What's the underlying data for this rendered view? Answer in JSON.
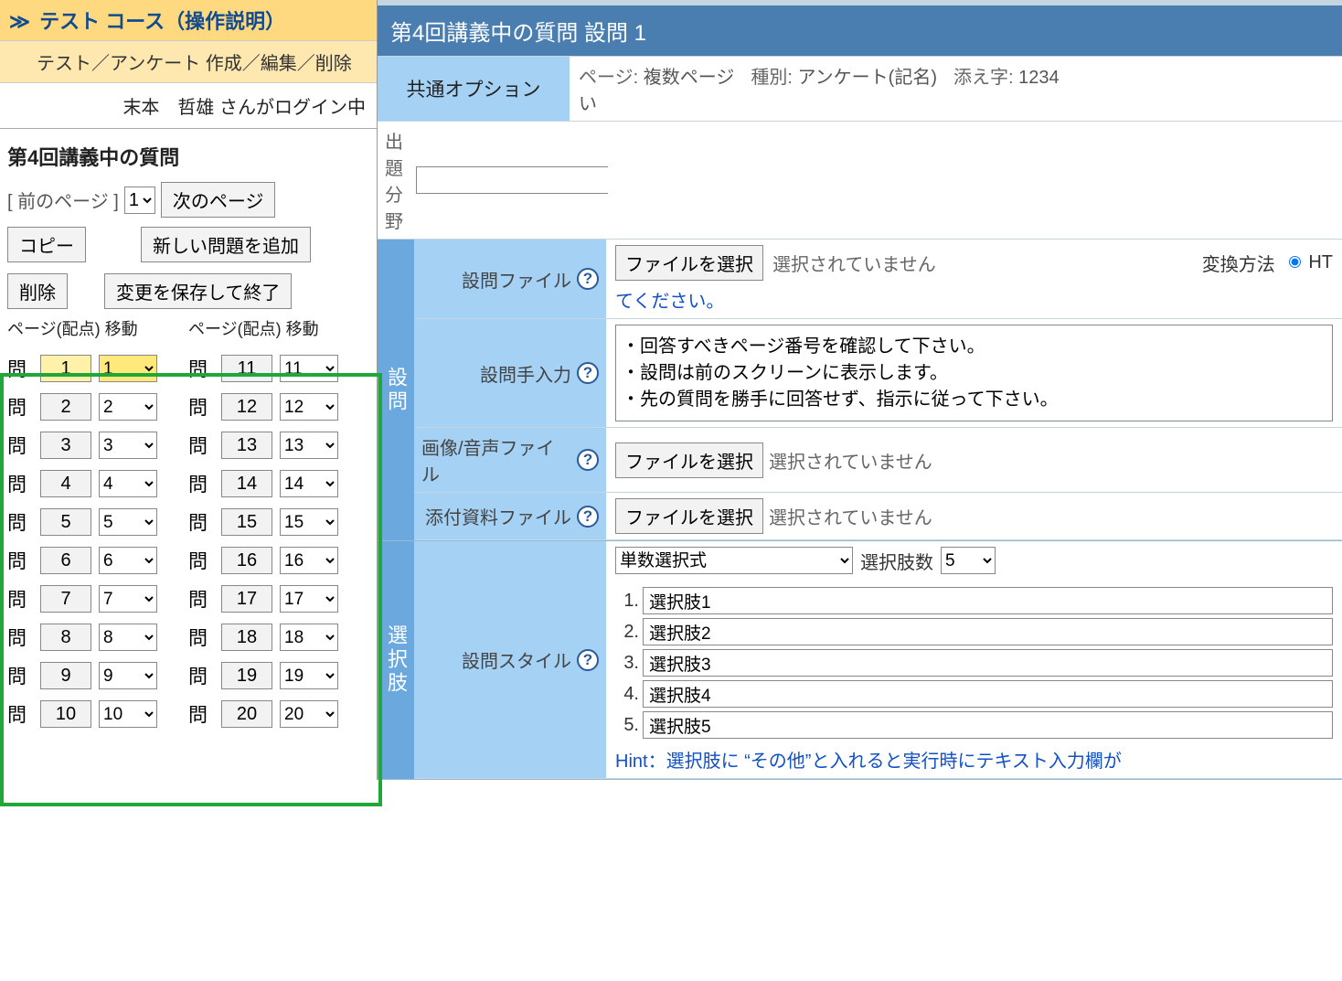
{
  "left": {
    "course_title": "テスト コース（操作説明）",
    "breadcrumb": "テスト／アンケート 作成／編集／削除",
    "login_status": "末本　哲雄 さんがログイン中",
    "qset_title": "第4回講義中の質問",
    "prev_label": "前のページ",
    "page_value": "1",
    "next_label": "次のページ",
    "copy_btn": "コピー",
    "add_btn": "新しい問題を追加",
    "delete_btn": "削除",
    "save_btn": "変更を保存して終了",
    "col_head_left": "ページ(配点) 移動",
    "col_head_right": "ページ(配点) 移動",
    "q_label": "問",
    "q_left": [
      {
        "n": "1",
        "p": "1"
      },
      {
        "n": "2",
        "p": "2"
      },
      {
        "n": "3",
        "p": "3"
      },
      {
        "n": "4",
        "p": "4"
      },
      {
        "n": "5",
        "p": "5"
      },
      {
        "n": "6",
        "p": "6"
      },
      {
        "n": "7",
        "p": "7"
      },
      {
        "n": "8",
        "p": "8"
      },
      {
        "n": "9",
        "p": "9"
      },
      {
        "n": "10",
        "p": "10"
      }
    ],
    "q_right": [
      {
        "n": "11",
        "p": "11"
      },
      {
        "n": "12",
        "p": "12"
      },
      {
        "n": "13",
        "p": "13"
      },
      {
        "n": "14",
        "p": "14"
      },
      {
        "n": "15",
        "p": "15"
      },
      {
        "n": "16",
        "p": "16"
      },
      {
        "n": "17",
        "p": "17"
      },
      {
        "n": "18",
        "p": "18"
      },
      {
        "n": "19",
        "p": "19"
      },
      {
        "n": "20",
        "p": "20"
      }
    ]
  },
  "right": {
    "header": "第4回講義中の質問  設問 1",
    "common": {
      "label": "共通オプション",
      "page_label": "ページ:",
      "page_value": "複数ページ",
      "type_label": "種別:",
      "type_value": "アンケート(記名)",
      "suffix_label": "添え字:",
      "suffix_value": "1234",
      "trailing": "い",
      "field_section_label": "出題分野"
    },
    "setsumon_vlabel": "設問",
    "file_row": {
      "label": "設問ファイル",
      "choose": "ファイルを選択",
      "nofile": "選択されていません",
      "convert_label": "変換方法",
      "convert_opt": "HT",
      "link_tail": "てください。"
    },
    "manual_row": {
      "label": "設問手入力",
      "text": "・回答すべきページ番号を確認して下さい。\n・設問は前のスクリーンに表示します。\n・先の質問を勝手に回答せず、指示に従って下さい。"
    },
    "media_row": {
      "label": "画像/音声ファイル",
      "choose": "ファイルを選択",
      "nofile": "選択されていません"
    },
    "attach_row": {
      "label": "添付資料ファイル",
      "choose": "ファイルを選択",
      "nofile": "選択されていません"
    },
    "choices_vlabel": "選択肢",
    "style_row": {
      "label": "設問スタイル",
      "style_value": "単数選択式",
      "count_label": "選択肢数",
      "count_value": "5"
    },
    "choices": [
      "選択肢1",
      "選択肢2",
      "選択肢3",
      "選択肢4",
      "選択肢5"
    ],
    "hint_prefix": "Hint：",
    "hint_text": "選択肢に “その他”と入れると実行時にテキスト入力欄が"
  }
}
